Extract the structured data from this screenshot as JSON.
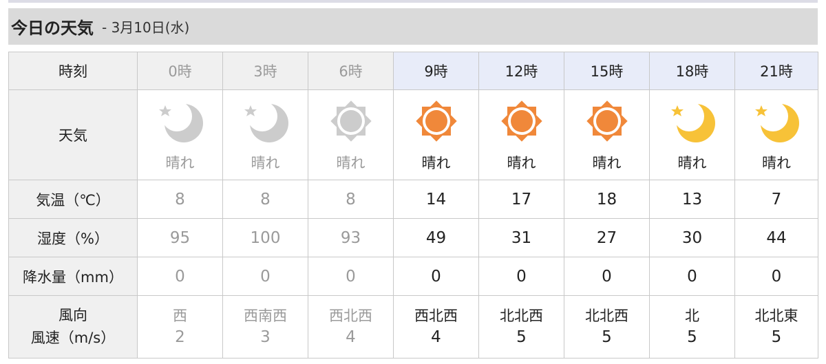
{
  "header": {
    "title": "今日の天気",
    "date": " - 3月10日(水)"
  },
  "row_labels": {
    "time": "時刻",
    "weather": "天気",
    "temp": "気温（℃）",
    "humidity": "湿度（%）",
    "rain": "降水量（mm）",
    "wind_dir": "風向",
    "wind_speed": "風速（m/s）"
  },
  "columns": [
    {
      "time": "0時",
      "status": "past",
      "icon": "moon-star-icon",
      "weather": "晴れ",
      "temp": "8",
      "humidity": "95",
      "rain": "0",
      "wind_dir": "西",
      "wind_speed": "2"
    },
    {
      "time": "3時",
      "status": "past",
      "icon": "moon-star-icon",
      "weather": "晴れ",
      "temp": "8",
      "humidity": "100",
      "rain": "0",
      "wind_dir": "西南西",
      "wind_speed": "3"
    },
    {
      "time": "6時",
      "status": "past",
      "icon": "sun-icon",
      "weather": "晴れ",
      "temp": "8",
      "humidity": "93",
      "rain": "0",
      "wind_dir": "西北西",
      "wind_speed": "4"
    },
    {
      "time": "9時",
      "status": "future",
      "icon": "sun-icon",
      "weather": "晴れ",
      "temp": "14",
      "humidity": "49",
      "rain": "0",
      "wind_dir": "西北西",
      "wind_speed": "4"
    },
    {
      "time": "12時",
      "status": "future",
      "icon": "sun-icon",
      "weather": "晴れ",
      "temp": "17",
      "humidity": "31",
      "rain": "0",
      "wind_dir": "北北西",
      "wind_speed": "5"
    },
    {
      "time": "15時",
      "status": "future",
      "icon": "sun-icon",
      "weather": "晴れ",
      "temp": "18",
      "humidity": "27",
      "rain": "0",
      "wind_dir": "北北西",
      "wind_speed": "5"
    },
    {
      "time": "18時",
      "status": "future",
      "icon": "moon-star-icon",
      "weather": "晴れ",
      "temp": "13",
      "humidity": "30",
      "rain": "0",
      "wind_dir": "北",
      "wind_speed": "5"
    },
    {
      "time": "21時",
      "status": "future",
      "icon": "moon-star-icon",
      "weather": "晴れ",
      "temp": "7",
      "humidity": "44",
      "rain": "0",
      "wind_dir": "北北東",
      "wind_speed": "5"
    }
  ],
  "colors": {
    "sun_active": "#f0883a",
    "moon_active": "#f7c238",
    "icon_past": "#cccccc",
    "header_bg": "#dadada",
    "future_header_bg": "#e8ecf9"
  }
}
